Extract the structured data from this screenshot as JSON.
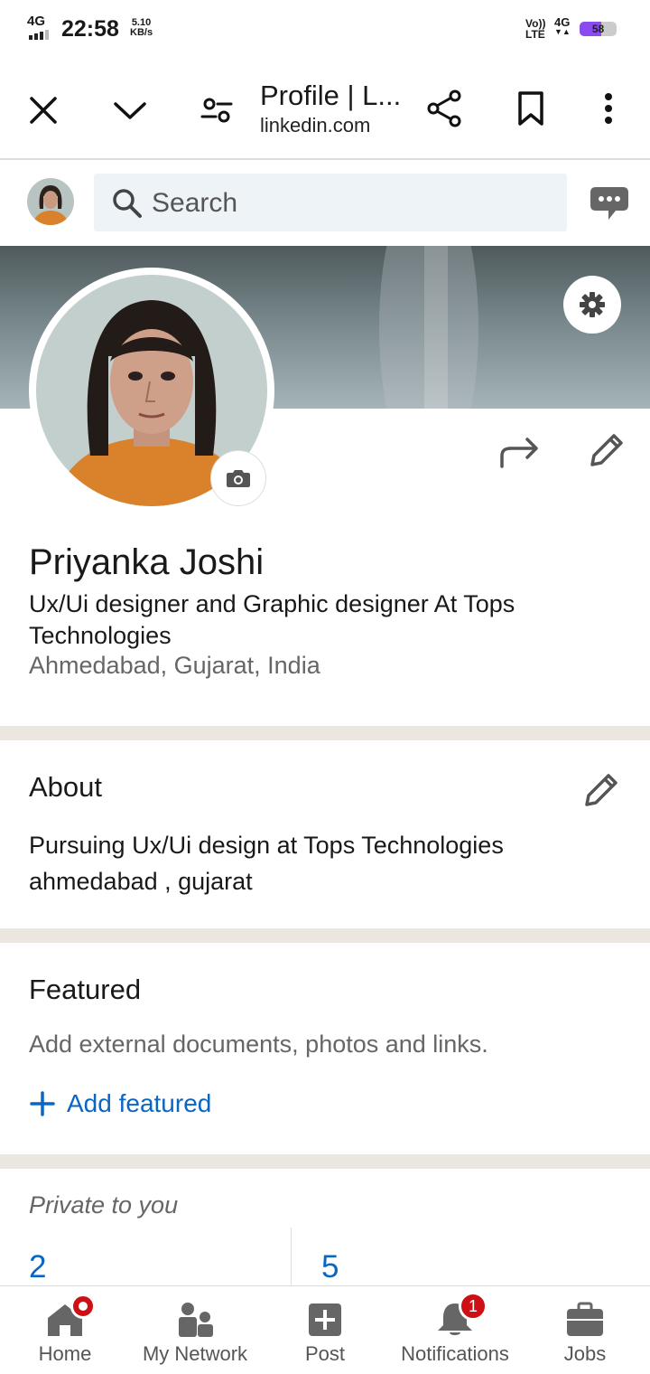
{
  "status_bar": {
    "network": "4G",
    "time": "22:58",
    "speed_value": "5.10",
    "speed_unit": "KB/s",
    "volte_line1": "Vo))",
    "volte_line2": "LTE",
    "network_right": "4G",
    "battery_level": "58",
    "battery_fraction": 0.58,
    "battery_color": "#8a4cf0"
  },
  "browser": {
    "page_title": "Profile | L...",
    "url": "linkedin.com",
    "icons": [
      "close-icon",
      "chevron-down-icon",
      "tune-icon",
      "share-icon",
      "bookmark-icon",
      "more-vertical-icon"
    ]
  },
  "linkedin_bar": {
    "search_placeholder": "Search",
    "icons": [
      "avatar",
      "search-icon",
      "messaging-icon"
    ]
  },
  "profile": {
    "name": "Priyanka Joshi",
    "headline": "Ux/Ui designer and Graphic designer At Tops Technologies",
    "location": "Ahmedabad, Gujarat, India"
  },
  "about": {
    "title": "About",
    "text": "Pursuing Ux/Ui design at Tops Technologies ahmedabad , gujarat"
  },
  "featured": {
    "title": "Featured",
    "subtitle": "Add external documents, photos and links.",
    "add_label": "Add featured"
  },
  "private": {
    "title": "Private to you",
    "stat1": "2",
    "stat2": "5"
  },
  "bottom_nav": {
    "home": "Home",
    "network": "My Network",
    "post": "Post",
    "notifications": "Notifications",
    "notifications_badge": "1",
    "jobs": "Jobs"
  },
  "colors": {
    "accent": "#0a66c2",
    "badge": "#cc1016",
    "divider": "#ebe6df"
  }
}
